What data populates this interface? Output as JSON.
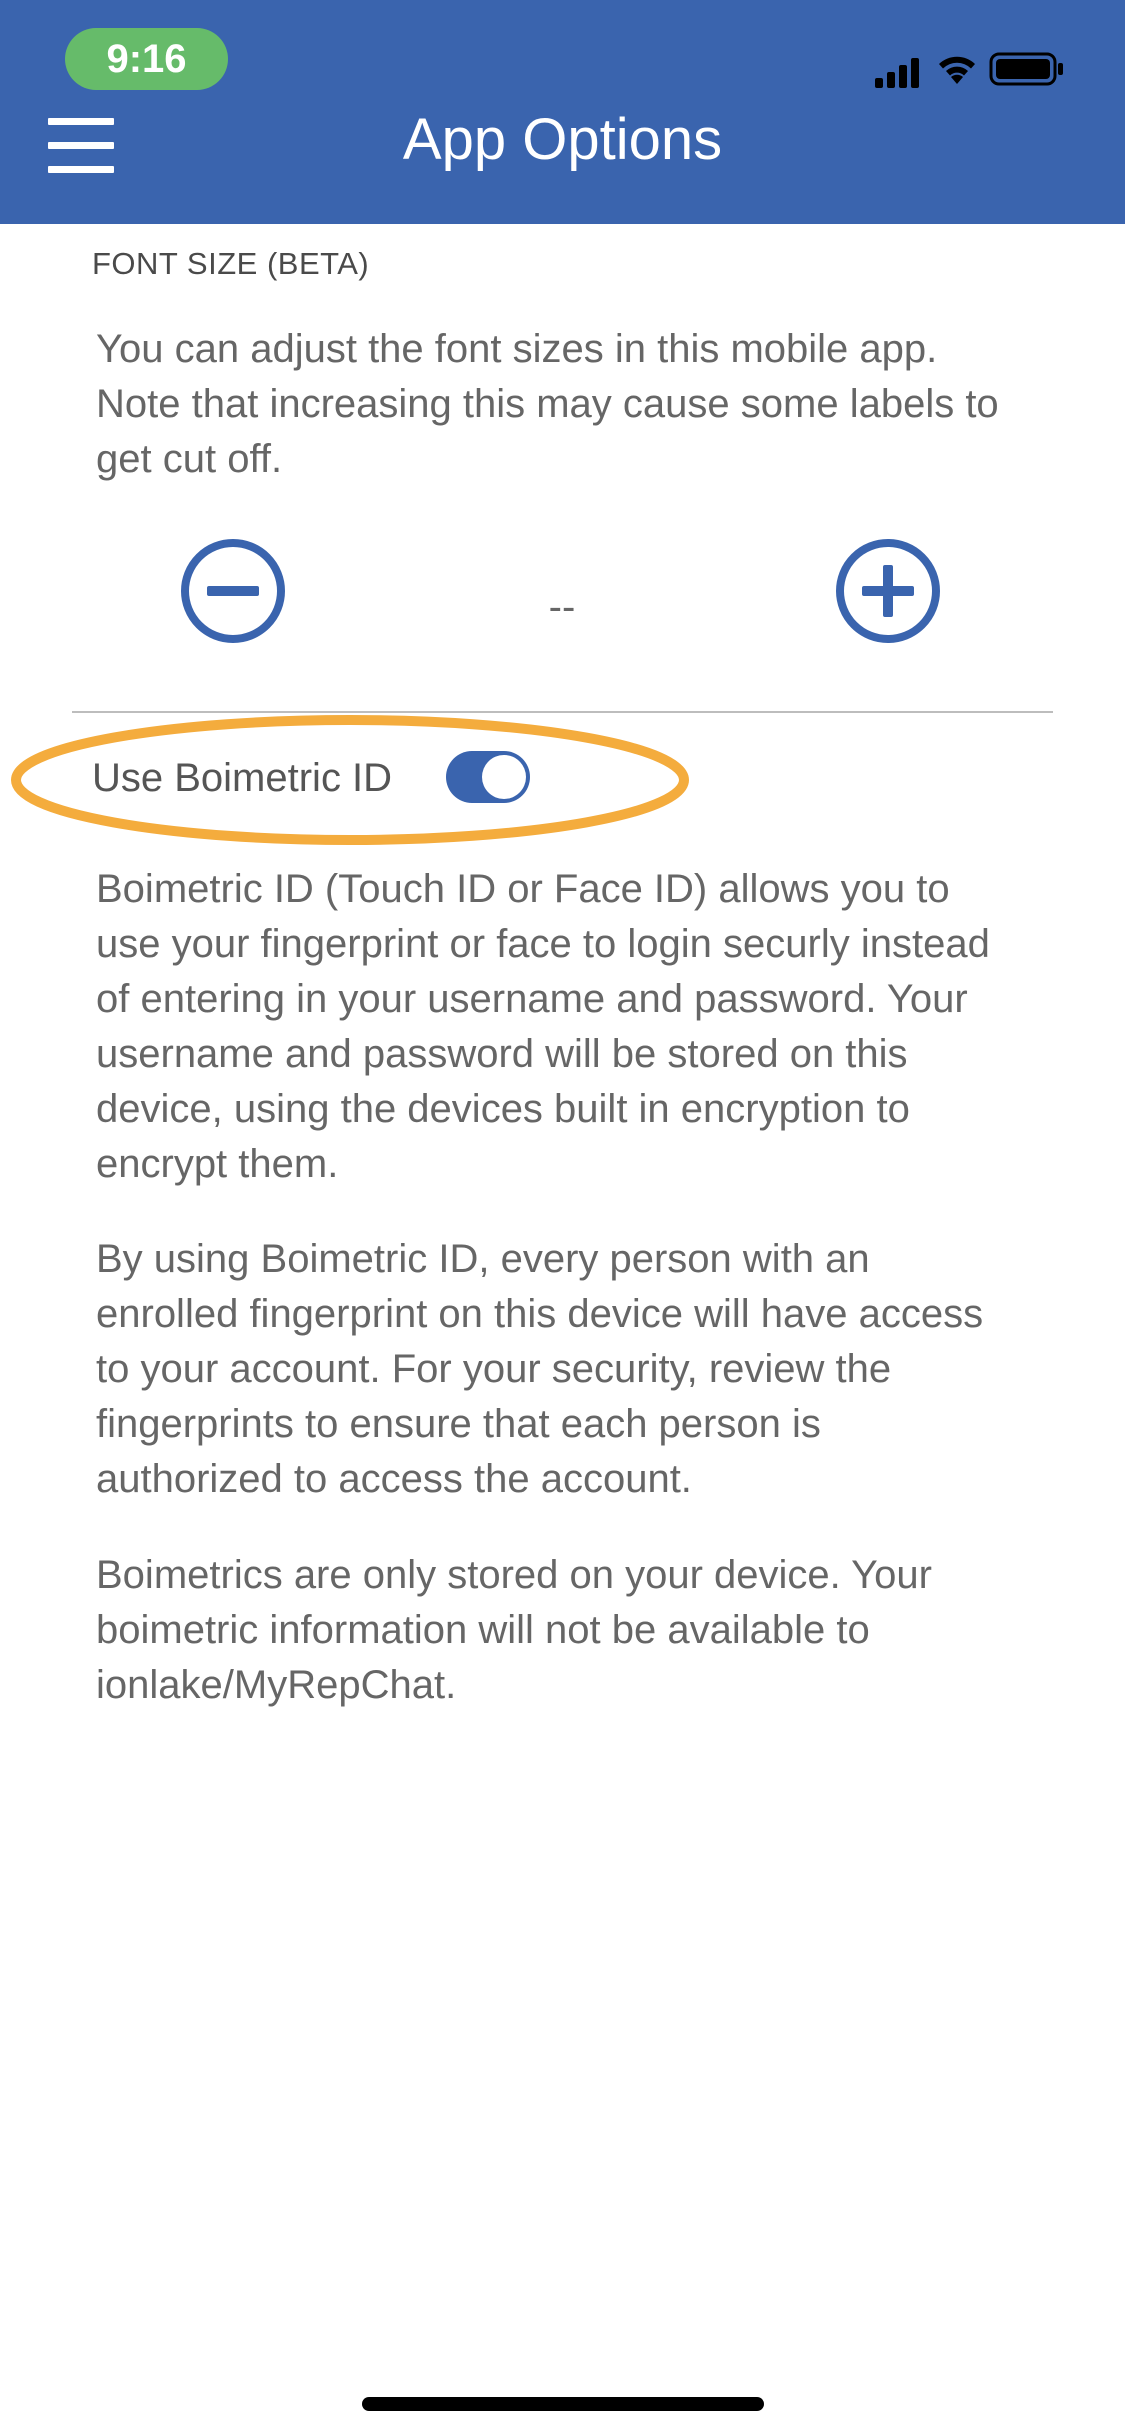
{
  "status_bar": {
    "time": "9:16",
    "icons": [
      "cellular-signal-icon",
      "wifi-icon",
      "battery-icon"
    ],
    "time_pill_color": "#66bb6a"
  },
  "header": {
    "title": "App Options",
    "background_color": "#3a64ae",
    "menu_icon": "hamburger-menu-icon"
  },
  "font_size": {
    "section_title": "FONT SIZE (BETA)",
    "description": "You can adjust the font sizes in this mobile app. Note that increasing this may cause some labels to get cut off.",
    "decrease_icon": "minus-circle-icon",
    "increase_icon": "plus-circle-icon",
    "current_value": "--"
  },
  "biometric": {
    "label": "Use Boimetric ID",
    "enabled": true,
    "highlight_color": "#f4ac3d",
    "paragraphs": [
      "Boimetric ID (Touch ID or Face ID) allows you to use your fingerprint or face to login securly instead of entering in your username and password. Your username and password will be stored on this device, using the devices built in encryption to encrypt them.",
      "By using Boimetric ID, every person with an enrolled fingerprint on this device will have access to your account. For your security, review the fingerprints to ensure that each person is authorized to access the account.",
      "Boimetrics are only stored on your device. Your boimetric information will not be available to ionlake/MyRepChat."
    ]
  },
  "accent_color": "#3a64ae"
}
